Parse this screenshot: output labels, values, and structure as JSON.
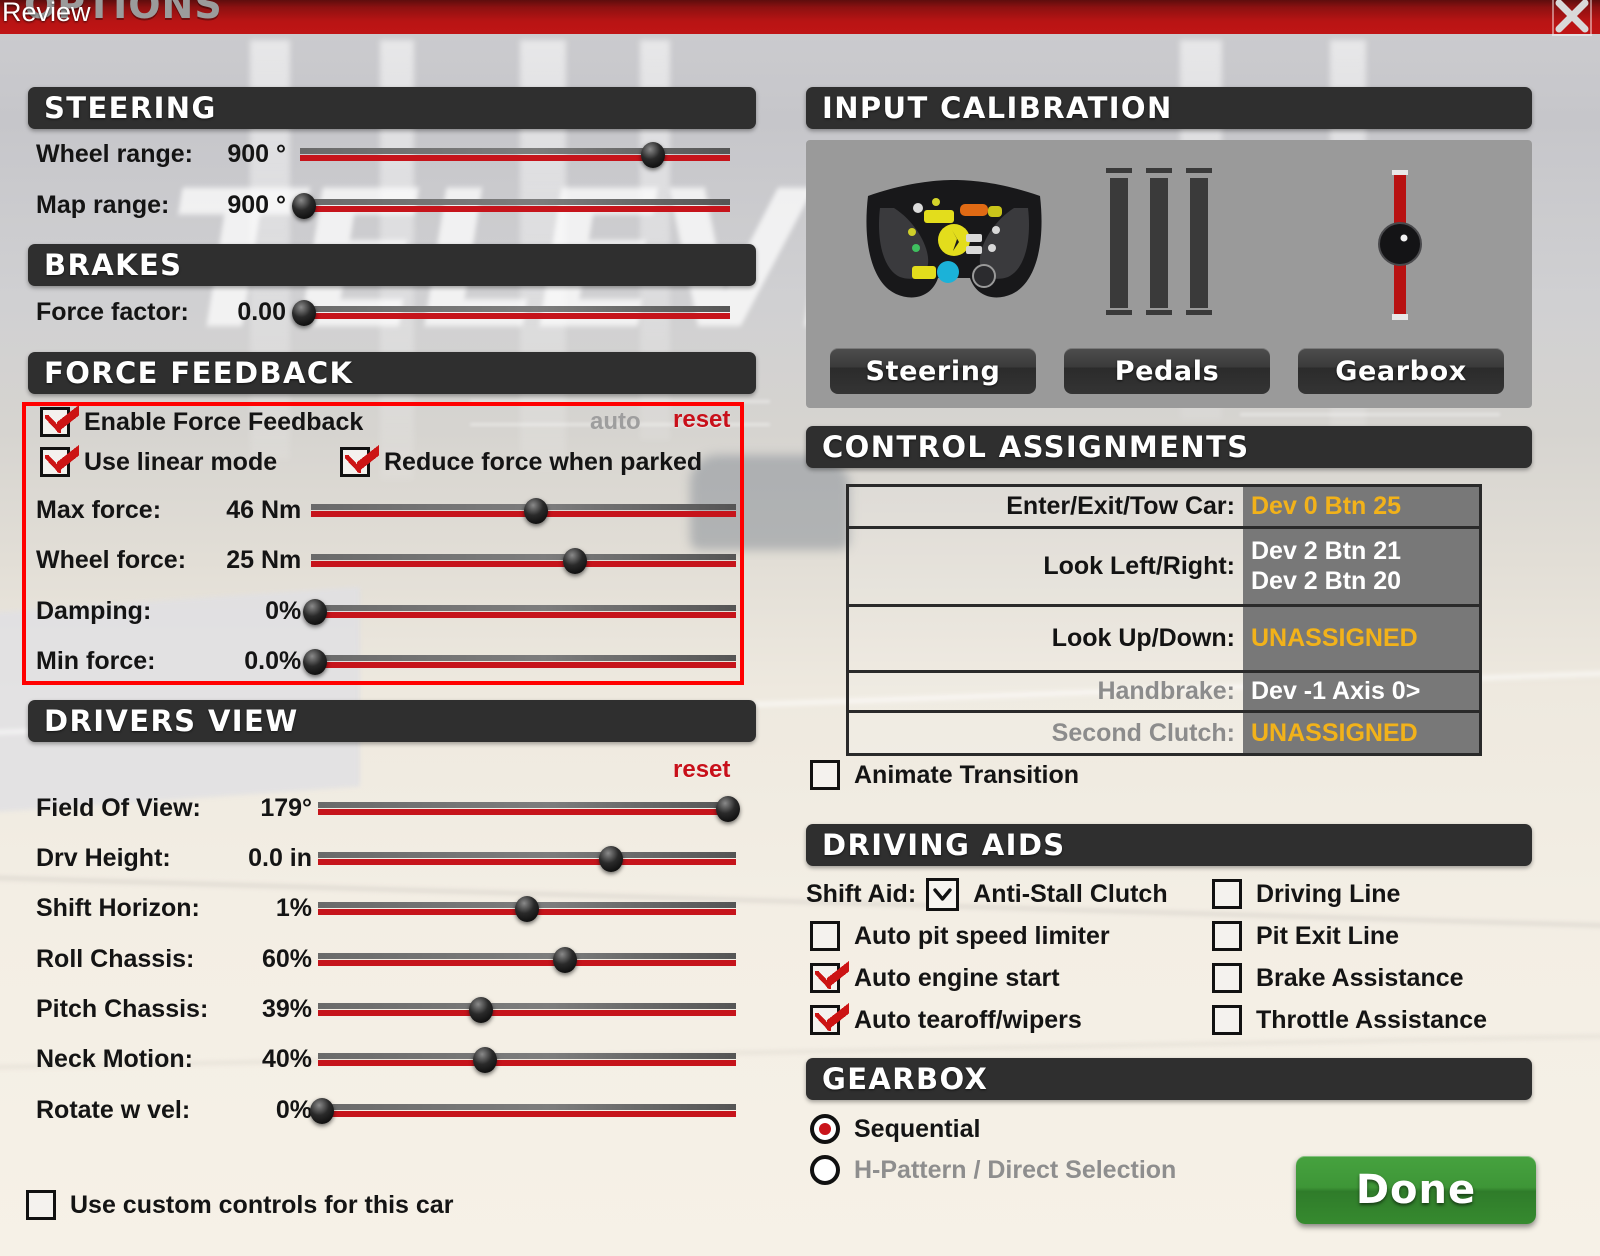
{
  "window": {
    "title": "OPTIONS",
    "overlay_badge": "Review",
    "close_icon": "close-icon"
  },
  "steering": {
    "header": "STEERING",
    "rows": [
      {
        "label": "Wheel range:",
        "value": "900 °",
        "pos": 82
      },
      {
        "label": "Map range:",
        "value": "900 °",
        "pos": 1
      }
    ]
  },
  "brakes": {
    "header": "BRAKES",
    "rows": [
      {
        "label": "Force factor:",
        "value": "0.00",
        "pos": 1
      }
    ]
  },
  "force_feedback": {
    "header": "FORCE FEEDBACK",
    "auto_label": "auto",
    "reset_label": "reset",
    "checkboxes": [
      {
        "label": "Enable Force Feedback",
        "checked": true
      },
      {
        "label": "Use linear mode",
        "checked": true
      },
      {
        "label": "Reduce force when parked",
        "checked": true
      }
    ],
    "rows": [
      {
        "label": "Max force:",
        "value": "46 Nm",
        "pos": 53
      },
      {
        "label": "Wheel force:",
        "value": "25 Nm",
        "pos": 62
      },
      {
        "label": "Damping:",
        "value": "0%",
        "pos": 1
      },
      {
        "label": "Min force:",
        "value": "0.0%",
        "pos": 1
      }
    ]
  },
  "drivers_view": {
    "header": "DRIVERS VIEW",
    "reset_label": "reset",
    "rows": [
      {
        "label": "Field Of View:",
        "value": "179°",
        "pos": 98
      },
      {
        "label": "Drv Height:",
        "value": "0.0 in",
        "pos": 70
      },
      {
        "label": "Shift Horizon:",
        "value": "1%",
        "pos": 50
      },
      {
        "label": "Roll Chassis:",
        "value": "60%",
        "pos": 59
      },
      {
        "label": "Pitch Chassis:",
        "value": "39%",
        "pos": 39
      },
      {
        "label": "Neck Motion:",
        "value": "40%",
        "pos": 40
      },
      {
        "label": "Rotate w vel:",
        "value": "0%",
        "pos": 1
      }
    ]
  },
  "custom_controls": {
    "label": "Use custom controls for this car",
    "checked": false
  },
  "input_calibration": {
    "header": "INPUT CALIBRATION",
    "icons": [
      "steering-wheel-icon",
      "pedals-icon",
      "gearbox-lever-icon"
    ],
    "buttons": [
      {
        "label": "Steering",
        "name": "steering-calibration-button"
      },
      {
        "label": "Pedals",
        "name": "pedals-calibration-button"
      },
      {
        "label": "Gearbox",
        "name": "gearbox-calibration-button"
      }
    ]
  },
  "control_assignments": {
    "header": "CONTROL ASSIGNMENTS",
    "rows": [
      {
        "key": "Enter/Exit/Tow Car:",
        "values": [
          "Dev 0 Btn 25"
        ],
        "amber": true,
        "dim": false
      },
      {
        "key": "Look Left/Right:",
        "values": [
          "Dev 2 Btn 21",
          "Dev 2 Btn 20"
        ],
        "amber": false,
        "dim": false
      },
      {
        "key": "Look Up/Down:",
        "values": [
          "UNASSIGNED"
        ],
        "amber": true,
        "dim": false
      },
      {
        "key": "Handbrake:",
        "values": [
          "Dev -1 Axis 0>"
        ],
        "amber": false,
        "dim": true
      },
      {
        "key": "Second Clutch:",
        "values": [
          "UNASSIGNED"
        ],
        "amber": true,
        "dim": true
      }
    ],
    "animate_transition": {
      "label": "Animate Transition",
      "checked": false
    }
  },
  "driving_aids": {
    "header": "DRIVING AIDS",
    "shift_aid_label": "Shift Aid:",
    "shift_aid_value": "Anti-Stall Clutch",
    "left_column": [
      {
        "label": "Auto pit speed limiter",
        "checked": false
      },
      {
        "label": "Auto engine start",
        "checked": true
      },
      {
        "label": "Auto tearoff/wipers",
        "checked": true
      }
    ],
    "right_column": [
      {
        "label": "Driving Line",
        "checked": false
      },
      {
        "label": "Pit Exit Line",
        "checked": false
      },
      {
        "label": "Brake Assistance",
        "checked": false
      },
      {
        "label": "Throttle Assistance",
        "checked": false
      }
    ]
  },
  "gearbox": {
    "header": "GEARBOX",
    "options": [
      {
        "label": "Sequential",
        "selected": true,
        "dim": false
      },
      {
        "label": "H-Pattern / Direct Selection",
        "selected": false,
        "dim": true
      }
    ]
  },
  "footer": {
    "done_label": "Done"
  },
  "colors": {
    "accent_red": "#c6141b",
    "header_bar": "#2f2f2f",
    "amber": "#f2b21a",
    "done_green": "#3e9637",
    "highlight_box": "#ff0000"
  }
}
